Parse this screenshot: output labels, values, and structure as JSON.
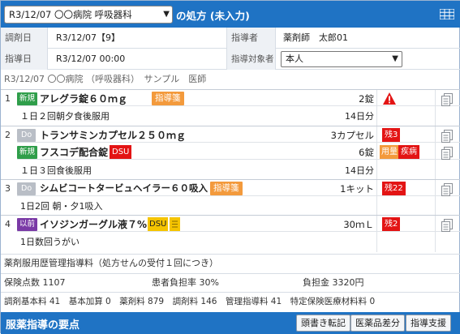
{
  "header": {
    "select_value": "R3/12/07 〇〇病院 呼吸器科",
    "title_suffix": "の処方 (未入力)",
    "grid_icon": "grid-menu-icon"
  },
  "fields": {
    "date_label": "調剤日",
    "date_value": "R3/12/07【9】",
    "instructor_label": "指導者",
    "instructor_value": "薬剤師　太郎01",
    "guide_date_label": "指導日",
    "guide_date_value": "R3/12/07 00:00",
    "target_label": "指導対象者",
    "target_value": "本人"
  },
  "info_line": "R3/12/07 〇〇病院 （呼吸器科）　サンプル　医師",
  "rx": [
    {
      "num": "1",
      "drugs": [
        {
          "badge": "新規",
          "name": "アレグラ錠６０ｍｇ",
          "tags": [
            {
              "text": "指導箋",
              "kind": "orange"
            }
          ],
          "qty": "2錠",
          "warn_icon": "warning-icon"
        }
      ],
      "usage": "１日２回朝夕食後服用",
      "days": "14日分"
    },
    {
      "num": "2",
      "drugs": [
        {
          "badge": "Do",
          "name": "トランサミンカプセル２５０ｍｇ",
          "qty": "3カプセル",
          "flags": [
            "残3"
          ]
        },
        {
          "badge": "新規",
          "name": "フスコデ配合錠",
          "tags": [
            {
              "text": "DSU",
              "kind": "red"
            }
          ],
          "qty": "6錠",
          "flags": [
            "用量",
            "疾病"
          ]
        }
      ],
      "usage": "１日３回食後服用",
      "days": "14日分"
    },
    {
      "num": "3",
      "drugs": [
        {
          "badge": "Do",
          "name": "シムビコートタービュヘイラー６０吸入",
          "tags": [
            {
              "text": "指導箋",
              "kind": "orange"
            }
          ],
          "qty": "1キット",
          "flags": [
            "残22"
          ]
        }
      ],
      "usage": "1日2回 朝・夕1吸入",
      "days": ""
    },
    {
      "num": "4",
      "drugs": [
        {
          "badge": "以前",
          "name": "イソジンガーグル液７%",
          "tags": [
            {
              "text": "DSU",
              "kind": "yellow"
            }
          ],
          "qty": "30ｍＬ",
          "flags": [
            "残2"
          ],
          "doc_icon": "note-icon"
        }
      ],
      "usage": "1日数回うがい",
      "days": ""
    }
  ],
  "summary": {
    "fee_label": "薬剤服用歴管理指導料（処方せんの受付１回につき）",
    "points": "保険点数 1107",
    "copay_rate": "患者負担率 30%",
    "copay": "負担金 3320円",
    "breakdown": "調剤基本料 41　基本加算 0　薬剤料 879　調剤料 146　管理指導料 41　特定保険医療材料料 0"
  },
  "footer": {
    "title": "服薬指導の要点",
    "btn1": "頭書き転記",
    "btn2": "医薬品差分",
    "btn3": "指導支援"
  }
}
